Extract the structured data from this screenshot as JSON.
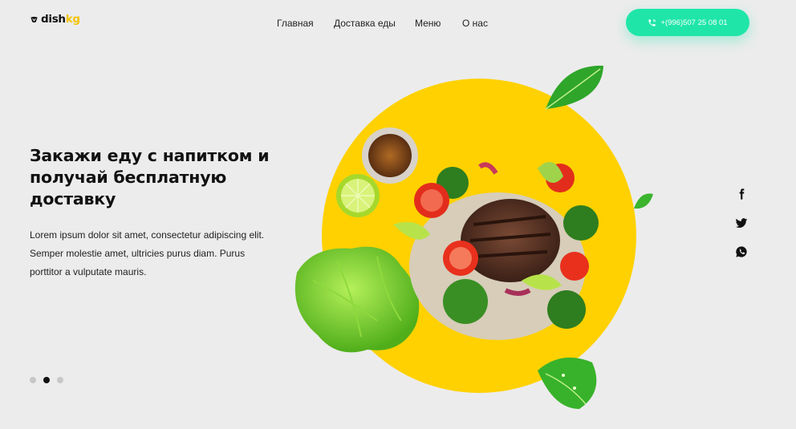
{
  "brand": {
    "name_part1": "dish",
    "name_part2": "kg",
    "accent_color": "#f2c400",
    "icon": "chef-hat-icon"
  },
  "nav": {
    "items": [
      "Главная",
      "Доставка еды",
      "Меню",
      "О нас"
    ]
  },
  "contact": {
    "phone": "+(996)507 25 08 01",
    "button_color": "#1fe6a8",
    "icon": "phone-icon"
  },
  "hero": {
    "title": "Закажи еду с напитком и получай бесплатную доставку",
    "text": "Lorem ipsum dolor sit amet, consectetur adipiscing elit. Semper molestie amet, ultricies purus diam. Purus porttitor a vulputate mauris.",
    "circle_color": "#ffd100"
  },
  "slider": {
    "count": 3,
    "active_index": 1
  },
  "social": {
    "icons": [
      "facebook-icon",
      "twitter-icon",
      "whatsapp-icon"
    ]
  }
}
